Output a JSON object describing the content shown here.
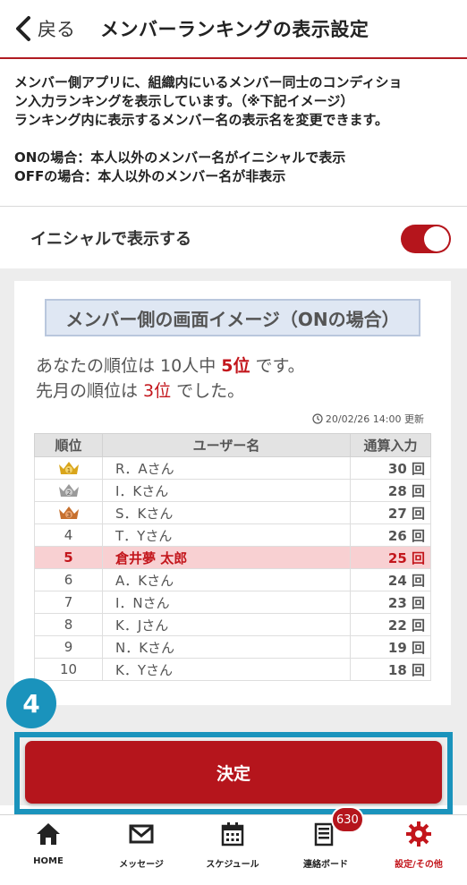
{
  "header": {
    "back_label": "戻る",
    "title": "メンバーランキングの表示設定"
  },
  "description": {
    "line1": "メンバー側アプリに、組織内にいるメンバー同士のコンディショ",
    "line2": "ン入力ランキングを表示しています。（※下記イメージ）",
    "line3": "ランキング内に表示するメンバー名の表示名を変更できます。",
    "line4": "ONの場合：本人以外のメンバー名がイニシャルで表示",
    "line5": "OFFの場合：本人以外のメンバー名が非表示"
  },
  "setting": {
    "label": "イニシャルで表示する",
    "toggle_on": true
  },
  "preview": {
    "title": "メンバー側の画面イメージ（ONの場合）",
    "rank_prefix": "あなたの順位は 10人中 ",
    "rank_value": "5位",
    "rank_suffix": " です。",
    "last_prefix": "先月の順位は ",
    "last_value": "3位",
    "last_suffix": " でした。",
    "updated": "20/02/26 14:00 更新",
    "columns": [
      "順位",
      "ユーザー名",
      "通算入力"
    ],
    "rows": [
      {
        "rank": "1",
        "name": "R．Aさん",
        "count": "30 回"
      },
      {
        "rank": "2",
        "name": "I．Kさん",
        "count": "28 回"
      },
      {
        "rank": "3",
        "name": "S．Kさん",
        "count": "27 回"
      },
      {
        "rank": "4",
        "name": "T．Yさん",
        "count": "26 回"
      },
      {
        "rank": "5",
        "name": "倉井夢 太郎",
        "count": "25 回"
      },
      {
        "rank": "6",
        "name": "A．Kさん",
        "count": "24 回"
      },
      {
        "rank": "7",
        "name": "I．Nさん",
        "count": "23 回"
      },
      {
        "rank": "8",
        "name": "K．Jさん",
        "count": "22 回"
      },
      {
        "rank": "9",
        "name": "N．Kさん",
        "count": "19 回"
      },
      {
        "rank": "10",
        "name": "K．Yさん",
        "count": "18 回"
      }
    ]
  },
  "step_badge": "4",
  "decide_label": "決定",
  "tabbar": {
    "items": [
      {
        "label": "HOME",
        "icon": "home-icon"
      },
      {
        "label": "メッセージ",
        "icon": "envelope-icon"
      },
      {
        "label": "スケジュール",
        "icon": "calendar-icon"
      },
      {
        "label": "連絡ボード",
        "icon": "board-icon",
        "badge": "630"
      },
      {
        "label": "設定/その他",
        "icon": "gear-icon"
      }
    ]
  },
  "colors": {
    "accent": "#b5151c",
    "highlight": "#1a93bc"
  }
}
